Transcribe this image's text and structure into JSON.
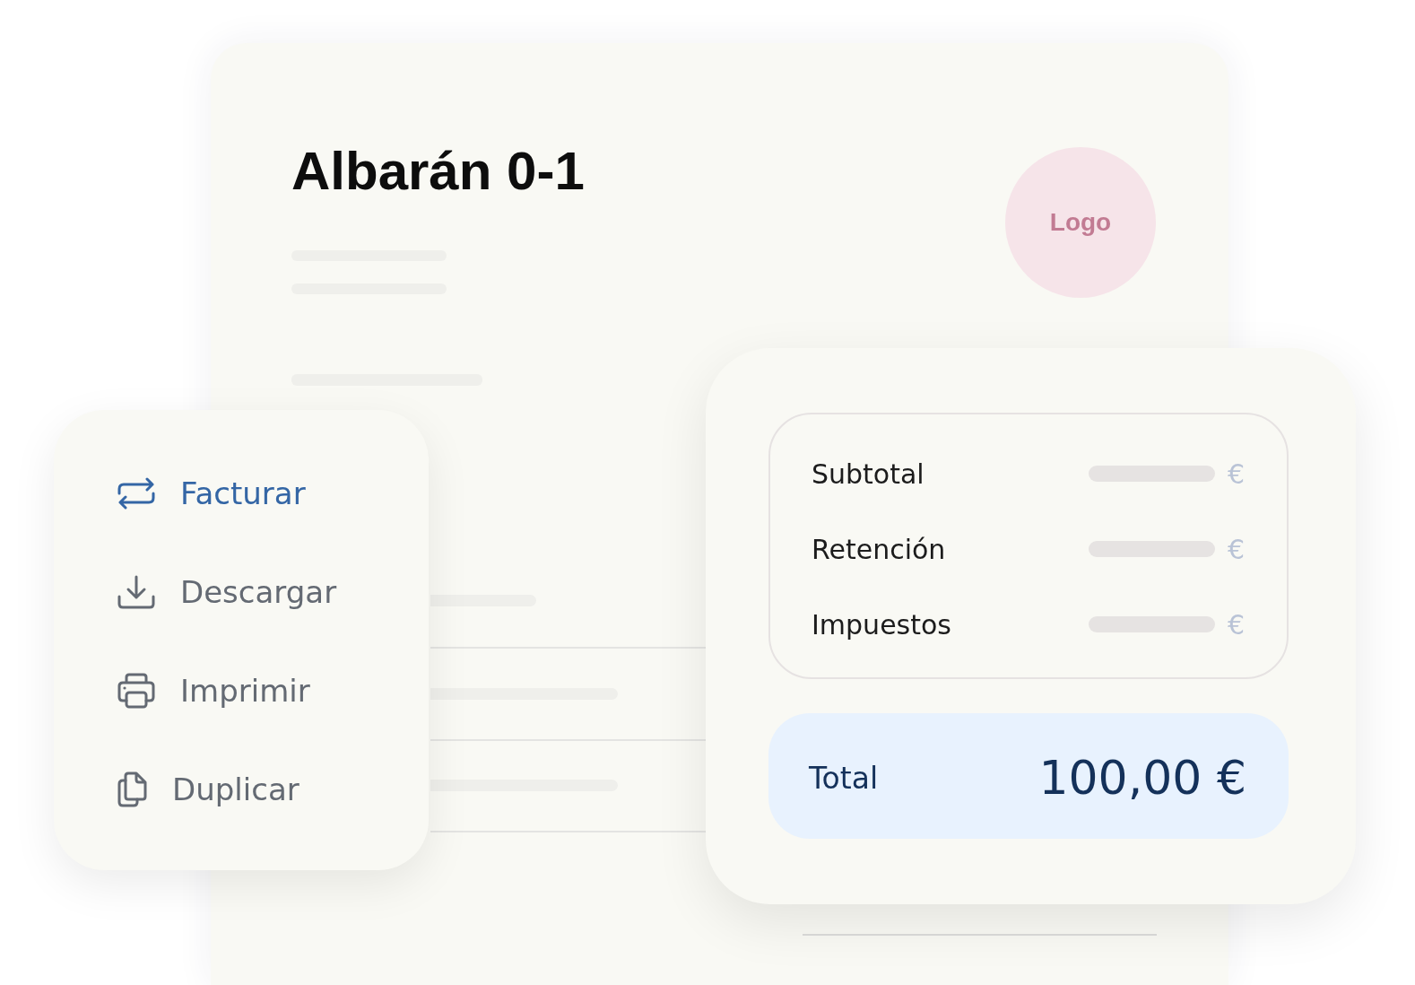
{
  "document": {
    "title": "Albarán 0-1",
    "logo": "Logo"
  },
  "actions": [
    {
      "kind": "invoice",
      "label": "Facturar",
      "selected": true
    },
    {
      "kind": "download",
      "label": "Descargar",
      "selected": false
    },
    {
      "kind": "print",
      "label": "Imprimir",
      "selected": false
    },
    {
      "kind": "duplicate",
      "label": "Duplicar",
      "selected": false
    }
  ],
  "totals": {
    "rows": [
      {
        "label": "Subtotal",
        "currency": "€"
      },
      {
        "label": "Retención",
        "currency": "€"
      },
      {
        "label": "Impuestos",
        "currency": "€"
      }
    ],
    "total": {
      "label": "Total",
      "amount": "100,00 €"
    }
  }
}
